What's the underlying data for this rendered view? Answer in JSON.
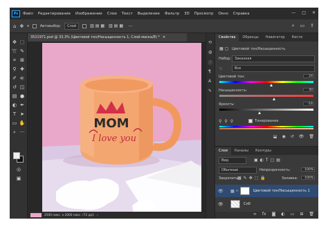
{
  "menu": {
    "logo": "Ps",
    "items": [
      "Файл",
      "Редактирование",
      "Изображение",
      "Слои",
      "Текст",
      "Выделение",
      "Фильтр",
      "3D",
      "Просмотр",
      "Окно",
      "Справка"
    ],
    "window_controls": [
      "—",
      "□",
      "✕"
    ]
  },
  "options": {
    "auto_select_label": "Автовыбор:",
    "auto_select_value": "Слой"
  },
  "document": {
    "tab_title": "3521971.psd @ 33,3% (Цветовой тон/Насыщенность 1, Слой-маска/8) *",
    "status": "2500 пикс. x 2000 пикс. (72 ppi)"
  },
  "canvas": {
    "mug_text_line1": "MOM",
    "mug_text_line2": "I love you"
  },
  "properties": {
    "tabs": [
      "Свойства",
      "Образцы",
      "Навигатор",
      "Кисти"
    ],
    "title": "Цветовой тон/Насыщенность",
    "preset_label": "Набор:",
    "preset_value": "Заказная",
    "channel_value": "Все",
    "hue_label": "Цветовой тон:",
    "hue_value": "24",
    "saturation_label": "Насыщенность:",
    "saturation_value": "40",
    "lightness_label": "Яркость:",
    "lightness_value": "-16",
    "colorize_label": "Тонирование",
    "colorize_checked": true
  },
  "layers": {
    "tabs": [
      "Слои",
      "Каналы",
      "Контуры"
    ],
    "filter_label": "Вид",
    "blend_mode": "Обычные",
    "opacity_label": "Непрозрачность:",
    "opacity_value": "100%",
    "lock_label": "Закрепить:",
    "fill_label": "Заливка:",
    "fill_value": "100%",
    "items": [
      {
        "name": "Цветовой тон/Насыщенность 1",
        "selected": true
      },
      {
        "name": "Сл0",
        "selected": false
      }
    ]
  },
  "colors": {
    "canvas_bg": "#e9a8c9",
    "mug": "#f4a671",
    "accent_selection": "#2f4b73"
  }
}
